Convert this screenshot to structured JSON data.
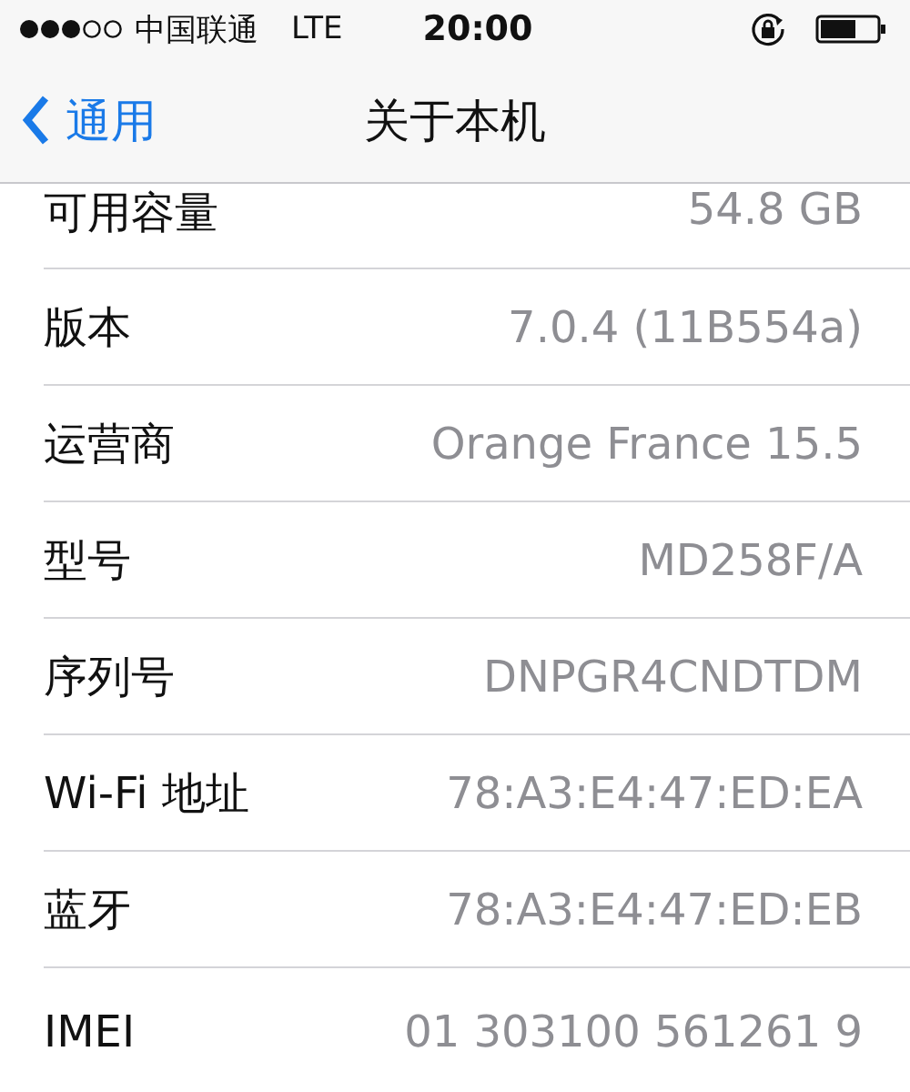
{
  "status_bar": {
    "carrier": "中国联通",
    "network": "LTE",
    "time": "20:00"
  },
  "nav": {
    "back": "通用",
    "title": "关于本机"
  },
  "rows": [
    {
      "label": "可用容量",
      "value": "54.8 GB"
    },
    {
      "label": "版本",
      "value": "7.0.4 (11B554a)"
    },
    {
      "label": "运营商",
      "value": "Orange France 15.5"
    },
    {
      "label": "型号",
      "value": "MD258F/A"
    },
    {
      "label": "序列号",
      "value": "DNPGR4CNDTDM"
    },
    {
      "label": "Wi-Fi 地址",
      "value": "78:A3:E4:47:ED:EA"
    },
    {
      "label": "蓝牙",
      "value": "78:A3:E4:47:ED:EB"
    },
    {
      "label": "IMEI",
      "value": "01 303100 561261 9"
    }
  ]
}
